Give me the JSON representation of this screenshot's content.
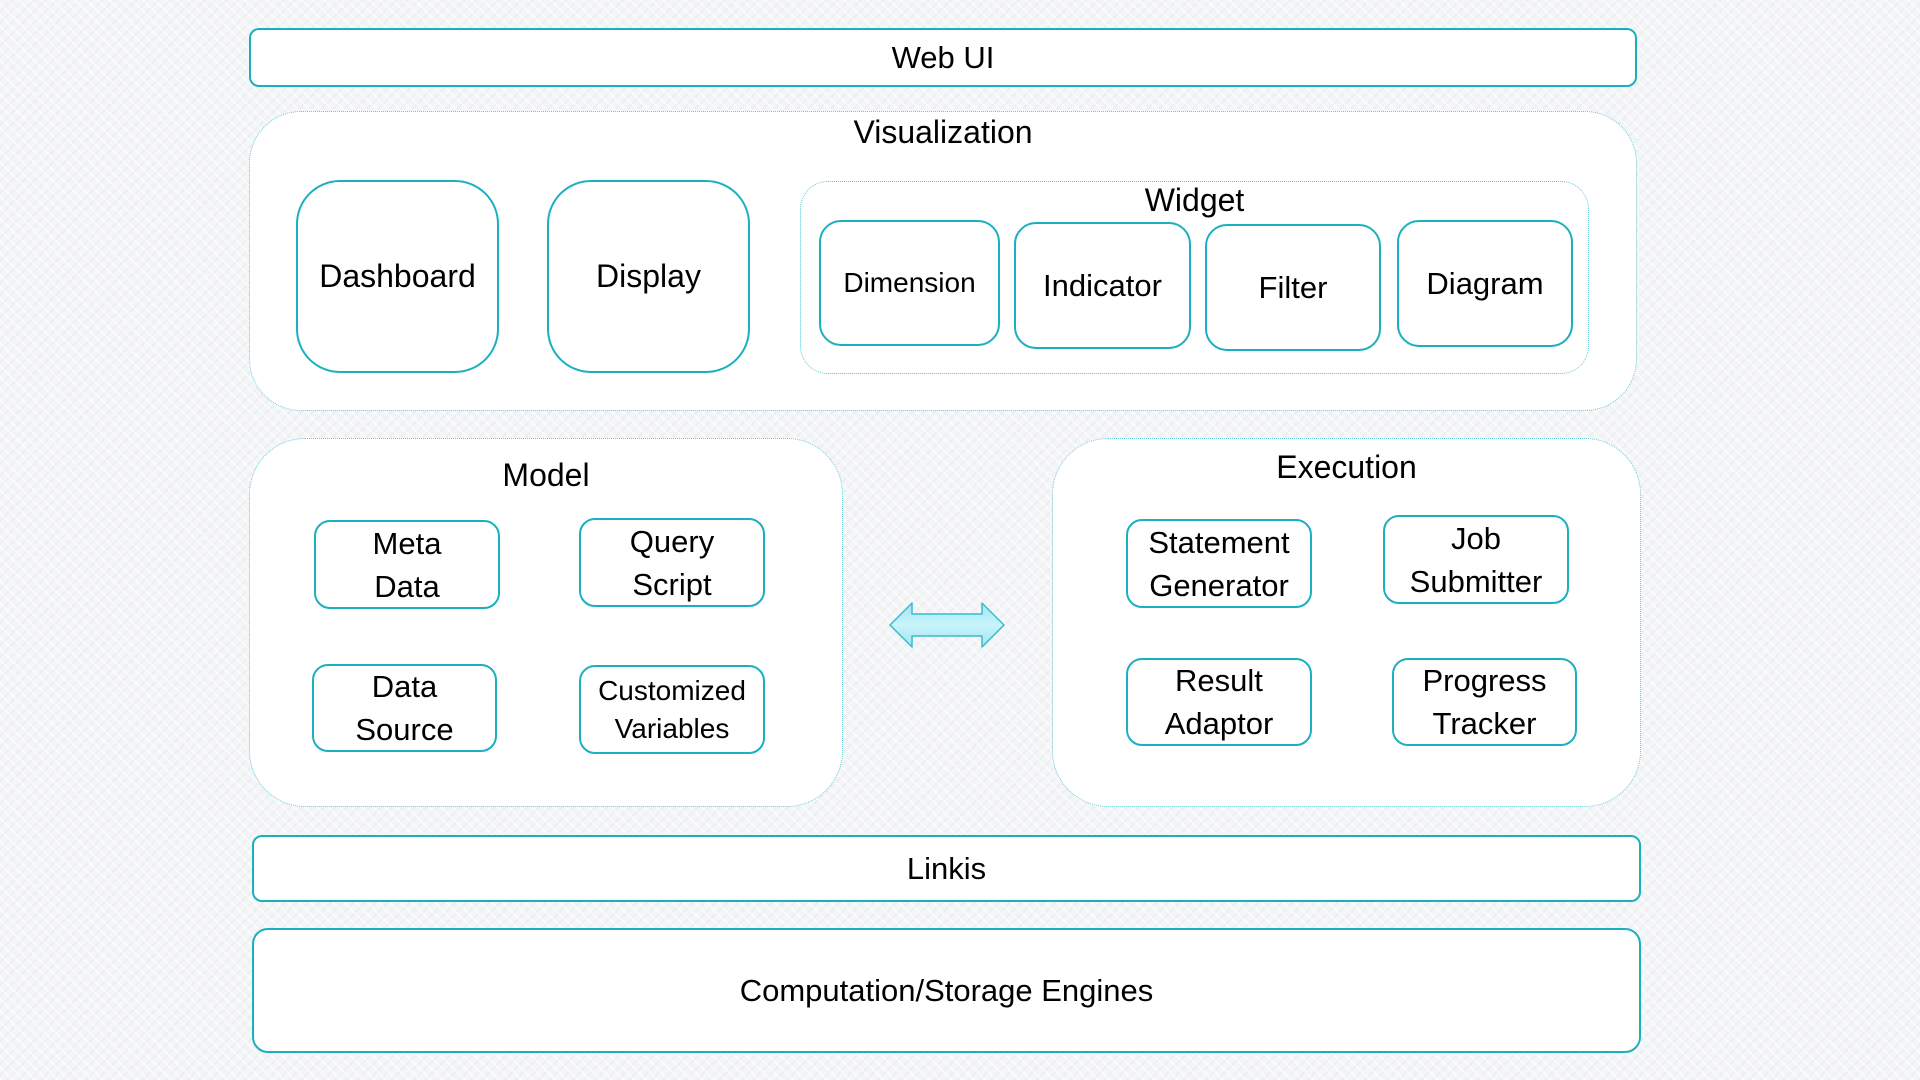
{
  "layers": {
    "web_ui": "Web UI",
    "visualization": {
      "title": "Visualization",
      "items": [
        "Dashboard",
        "Display"
      ],
      "widget": {
        "title": "Widget",
        "items": [
          "Dimension",
          "Indicator",
          "Filter",
          "Diagram"
        ]
      }
    },
    "model": {
      "title": "Model",
      "items": [
        [
          "Meta",
          "Data"
        ],
        [
          "Query",
          "Script"
        ],
        [
          "Data",
          "Source"
        ],
        [
          "Customized",
          "Variables"
        ]
      ]
    },
    "connector": {
      "icon": "double-arrow-icon",
      "color": "#b8eef6"
    },
    "execution": {
      "title": "Execution",
      "items": [
        [
          "Statement",
          "Generator"
        ],
        [
          "Job",
          "Submitter"
        ],
        [
          "Result",
          "Adaptor"
        ],
        [
          "Progress",
          "Tracker"
        ]
      ]
    },
    "linkis": "Linkis",
    "engines": "Computation/Storage Engines"
  },
  "colors": {
    "border": "#1ab0c0",
    "dotted_border": "#5fc8d4",
    "background": "#f4f5f7"
  }
}
